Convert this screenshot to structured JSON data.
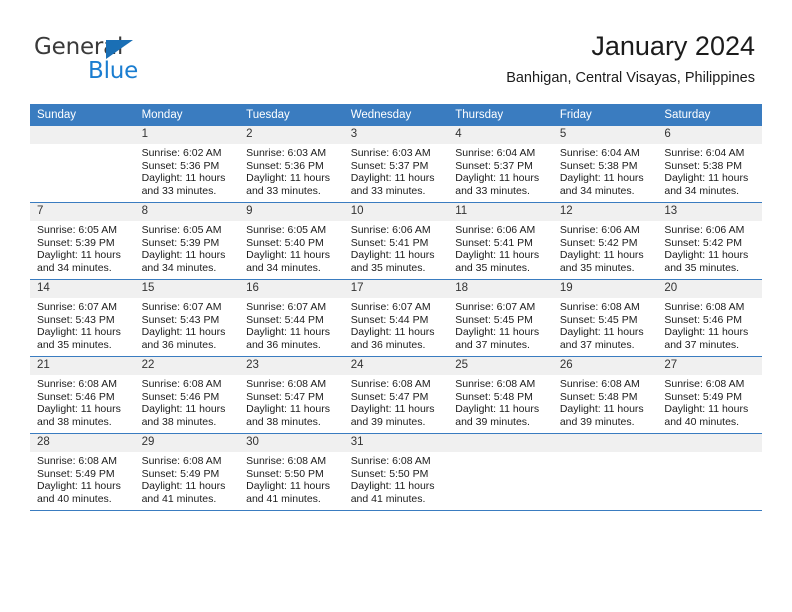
{
  "brand": {
    "name_part1": "General",
    "name_part2": "Blue",
    "triangle_icon": "brand-triangle-icon",
    "accent_color": "#1a7dd0"
  },
  "header": {
    "title": "January 2024",
    "subtitle": "Banhigan, Central Visayas, Philippines"
  },
  "theme": {
    "header_row_color": "#3a7cc0",
    "daynum_band_color": "#f0f0f0",
    "text_color": "#1c1c1c"
  },
  "calendar": {
    "weekday_headers": [
      "Sunday",
      "Monday",
      "Tuesday",
      "Wednesday",
      "Thursday",
      "Friday",
      "Saturday"
    ],
    "weeks": [
      [
        {
          "day": "",
          "sunrise": "",
          "sunset": "",
          "daylight": "",
          "blank": true
        },
        {
          "day": "1",
          "sunrise": "Sunrise: 6:02 AM",
          "sunset": "Sunset: 5:36 PM",
          "daylight": "Daylight: 11 hours and 33 minutes."
        },
        {
          "day": "2",
          "sunrise": "Sunrise: 6:03 AM",
          "sunset": "Sunset: 5:36 PM",
          "daylight": "Daylight: 11 hours and 33 minutes."
        },
        {
          "day": "3",
          "sunrise": "Sunrise: 6:03 AM",
          "sunset": "Sunset: 5:37 PM",
          "daylight": "Daylight: 11 hours and 33 minutes."
        },
        {
          "day": "4",
          "sunrise": "Sunrise: 6:04 AM",
          "sunset": "Sunset: 5:37 PM",
          "daylight": "Daylight: 11 hours and 33 minutes."
        },
        {
          "day": "5",
          "sunrise": "Sunrise: 6:04 AM",
          "sunset": "Sunset: 5:38 PM",
          "daylight": "Daylight: 11 hours and 34 minutes."
        },
        {
          "day": "6",
          "sunrise": "Sunrise: 6:04 AM",
          "sunset": "Sunset: 5:38 PM",
          "daylight": "Daylight: 11 hours and 34 minutes."
        }
      ],
      [
        {
          "day": "7",
          "sunrise": "Sunrise: 6:05 AM",
          "sunset": "Sunset: 5:39 PM",
          "daylight": "Daylight: 11 hours and 34 minutes."
        },
        {
          "day": "8",
          "sunrise": "Sunrise: 6:05 AM",
          "sunset": "Sunset: 5:39 PM",
          "daylight": "Daylight: 11 hours and 34 minutes."
        },
        {
          "day": "9",
          "sunrise": "Sunrise: 6:05 AM",
          "sunset": "Sunset: 5:40 PM",
          "daylight": "Daylight: 11 hours and 34 minutes."
        },
        {
          "day": "10",
          "sunrise": "Sunrise: 6:06 AM",
          "sunset": "Sunset: 5:41 PM",
          "daylight": "Daylight: 11 hours and 35 minutes."
        },
        {
          "day": "11",
          "sunrise": "Sunrise: 6:06 AM",
          "sunset": "Sunset: 5:41 PM",
          "daylight": "Daylight: 11 hours and 35 minutes."
        },
        {
          "day": "12",
          "sunrise": "Sunrise: 6:06 AM",
          "sunset": "Sunset: 5:42 PM",
          "daylight": "Daylight: 11 hours and 35 minutes."
        },
        {
          "day": "13",
          "sunrise": "Sunrise: 6:06 AM",
          "sunset": "Sunset: 5:42 PM",
          "daylight": "Daylight: 11 hours and 35 minutes."
        }
      ],
      [
        {
          "day": "14",
          "sunrise": "Sunrise: 6:07 AM",
          "sunset": "Sunset: 5:43 PM",
          "daylight": "Daylight: 11 hours and 35 minutes."
        },
        {
          "day": "15",
          "sunrise": "Sunrise: 6:07 AM",
          "sunset": "Sunset: 5:43 PM",
          "daylight": "Daylight: 11 hours and 36 minutes."
        },
        {
          "day": "16",
          "sunrise": "Sunrise: 6:07 AM",
          "sunset": "Sunset: 5:44 PM",
          "daylight": "Daylight: 11 hours and 36 minutes."
        },
        {
          "day": "17",
          "sunrise": "Sunrise: 6:07 AM",
          "sunset": "Sunset: 5:44 PM",
          "daylight": "Daylight: 11 hours and 36 minutes."
        },
        {
          "day": "18",
          "sunrise": "Sunrise: 6:07 AM",
          "sunset": "Sunset: 5:45 PM",
          "daylight": "Daylight: 11 hours and 37 minutes."
        },
        {
          "day": "19",
          "sunrise": "Sunrise: 6:08 AM",
          "sunset": "Sunset: 5:45 PM",
          "daylight": "Daylight: 11 hours and 37 minutes."
        },
        {
          "day": "20",
          "sunrise": "Sunrise: 6:08 AM",
          "sunset": "Sunset: 5:46 PM",
          "daylight": "Daylight: 11 hours and 37 minutes."
        }
      ],
      [
        {
          "day": "21",
          "sunrise": "Sunrise: 6:08 AM",
          "sunset": "Sunset: 5:46 PM",
          "daylight": "Daylight: 11 hours and 38 minutes."
        },
        {
          "day": "22",
          "sunrise": "Sunrise: 6:08 AM",
          "sunset": "Sunset: 5:46 PM",
          "daylight": "Daylight: 11 hours and 38 minutes."
        },
        {
          "day": "23",
          "sunrise": "Sunrise: 6:08 AM",
          "sunset": "Sunset: 5:47 PM",
          "daylight": "Daylight: 11 hours and 38 minutes."
        },
        {
          "day": "24",
          "sunrise": "Sunrise: 6:08 AM",
          "sunset": "Sunset: 5:47 PM",
          "daylight": "Daylight: 11 hours and 39 minutes."
        },
        {
          "day": "25",
          "sunrise": "Sunrise: 6:08 AM",
          "sunset": "Sunset: 5:48 PM",
          "daylight": "Daylight: 11 hours and 39 minutes."
        },
        {
          "day": "26",
          "sunrise": "Sunrise: 6:08 AM",
          "sunset": "Sunset: 5:48 PM",
          "daylight": "Daylight: 11 hours and 39 minutes."
        },
        {
          "day": "27",
          "sunrise": "Sunrise: 6:08 AM",
          "sunset": "Sunset: 5:49 PM",
          "daylight": "Daylight: 11 hours and 40 minutes."
        }
      ],
      [
        {
          "day": "28",
          "sunrise": "Sunrise: 6:08 AM",
          "sunset": "Sunset: 5:49 PM",
          "daylight": "Daylight: 11 hours and 40 minutes."
        },
        {
          "day": "29",
          "sunrise": "Sunrise: 6:08 AM",
          "sunset": "Sunset: 5:49 PM",
          "daylight": "Daylight: 11 hours and 41 minutes."
        },
        {
          "day": "30",
          "sunrise": "Sunrise: 6:08 AM",
          "sunset": "Sunset: 5:50 PM",
          "daylight": "Daylight: 11 hours and 41 minutes."
        },
        {
          "day": "31",
          "sunrise": "Sunrise: 6:08 AM",
          "sunset": "Sunset: 5:50 PM",
          "daylight": "Daylight: 11 hours and 41 minutes."
        },
        {
          "day": "",
          "sunrise": "",
          "sunset": "",
          "daylight": "",
          "blank": true
        },
        {
          "day": "",
          "sunrise": "",
          "sunset": "",
          "daylight": "",
          "blank": true
        },
        {
          "day": "",
          "sunrise": "",
          "sunset": "",
          "daylight": "",
          "blank": true
        }
      ]
    ]
  }
}
